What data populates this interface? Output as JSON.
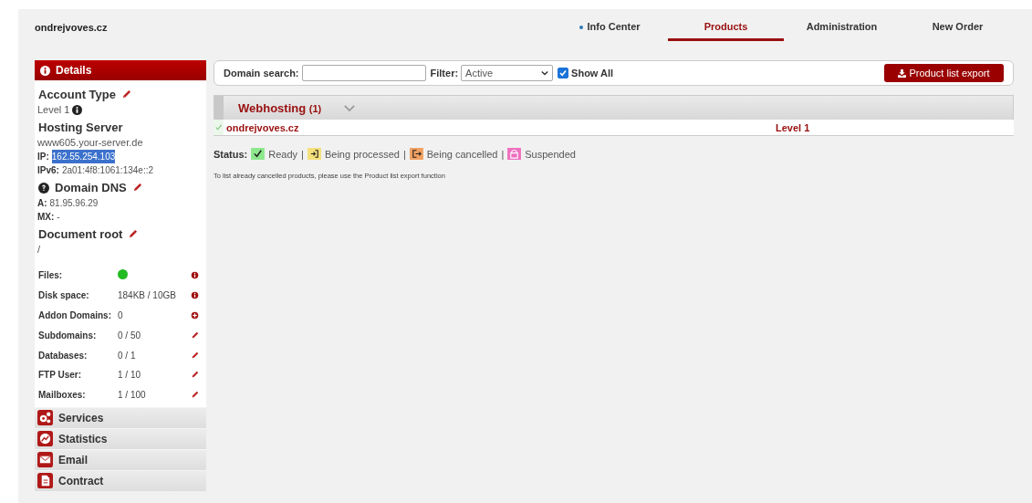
{
  "site": "ondrejvoves.cz",
  "nav": [
    {
      "label": "Info Center",
      "selected": false,
      "marked": true
    },
    {
      "label": "Products",
      "selected": true,
      "marked": false
    },
    {
      "label": "Administration",
      "selected": false,
      "marked": false
    },
    {
      "label": "New Order",
      "selected": false,
      "marked": false
    }
  ],
  "details": {
    "title": "Details",
    "account_type": {
      "heading": "Account Type",
      "value": "Level 1"
    },
    "hosting": {
      "heading": "Hosting Server",
      "server": "www605.your-server.de",
      "ip_label": "IP:",
      "ip": "162.55.254.103",
      "ip_selected": true,
      "ipv6_label": "IPv6:",
      "ipv6": "2a01:4f8:1061:134e::2"
    },
    "dns": {
      "heading": "Domain DNS",
      "a_label": "A:",
      "a": "81.95.96.29",
      "mx_label": "MX:",
      "mx": "-"
    },
    "docroot": {
      "heading": "Document root",
      "value": "/"
    },
    "stats": [
      {
        "label": "Files:",
        "on": true,
        "kind": "info"
      },
      {
        "label": "Disk space:",
        "value": "184KB / 10GB",
        "kind": "info"
      },
      {
        "label": "Addon Domains:",
        "value": "0",
        "kind": "add"
      },
      {
        "label": "Subdomains:",
        "value": "0 / 50",
        "kind": "edit"
      },
      {
        "label": "Databases:",
        "value": "0 / 1",
        "kind": "edit"
      },
      {
        "label": "FTP User:",
        "value": "1 / 10",
        "kind": "edit"
      },
      {
        "label": "Mailboxes:",
        "value": "1 / 100",
        "kind": "edit"
      }
    ]
  },
  "sections": [
    {
      "label": "Services",
      "kind": "services"
    },
    {
      "label": "Statistics",
      "kind": "statistics"
    },
    {
      "label": "Email",
      "kind": "email"
    },
    {
      "label": "Contract",
      "kind": "contract"
    }
  ],
  "toolbar": {
    "search_label": "Domain search:",
    "filter_label": "Filter:",
    "filter_value": "Active",
    "show_all_label": "Show All",
    "show_all_checked": true,
    "export_label": "Product list export"
  },
  "group": {
    "title": "Webhosting",
    "count": "(1)",
    "expanded": false
  },
  "products": [
    {
      "domain": "ondrejvoves.cz",
      "level": "Level 1",
      "kind": "ready"
    }
  ],
  "legend": {
    "label": "Status:",
    "items": [
      {
        "label": "Ready",
        "kind": "ready",
        "color": "#8de88d",
        "separator": "|"
      },
      {
        "label": "Being processed",
        "kind": "processing",
        "color": "#f5e07a",
        "separator": "|"
      },
      {
        "label": "Being cancelled",
        "kind": "cancelling",
        "color": "#f2a060",
        "separator": "|"
      },
      {
        "label": "Suspended",
        "kind": "suspended",
        "color": "#ef6fbf"
      }
    ]
  },
  "note": "To list already cancelled products, please use the Product list export function"
}
